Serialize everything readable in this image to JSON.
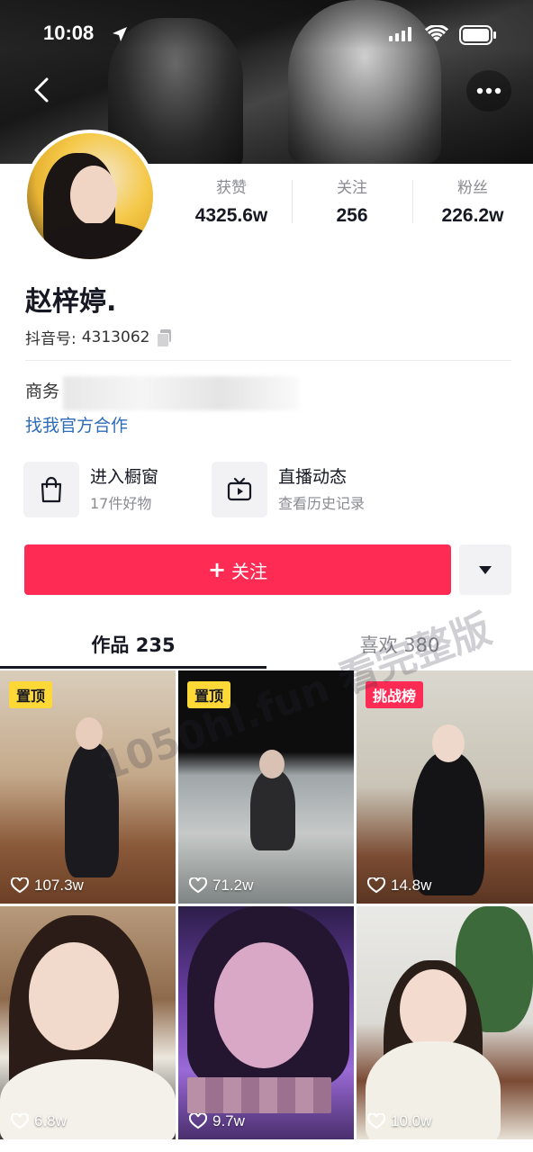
{
  "status_bar": {
    "time": "10:08"
  },
  "profile": {
    "name": "赵梓婷.",
    "douyin_id_label": "抖音号:",
    "douyin_id": "4313062",
    "business_label": "商务",
    "official_link": "找我官方合作"
  },
  "stats": [
    {
      "label": "获赞",
      "value": "4325.6w"
    },
    {
      "label": "关注",
      "value": "256"
    },
    {
      "label": "粉丝",
      "value": "226.2w"
    }
  ],
  "features": [
    {
      "title": "进入橱窗",
      "subtitle": "17件好物",
      "icon": "shopping-bag-icon"
    },
    {
      "title": "直播动态",
      "subtitle": "查看历史记录",
      "icon": "tv-icon"
    }
  ],
  "follow_button": {
    "plus": "+",
    "label": "关注"
  },
  "tabs": [
    {
      "label": "作品 235"
    },
    {
      "label": "喜欢 380"
    }
  ],
  "videos": [
    {
      "badge": "置顶",
      "likes": "107.3w"
    },
    {
      "badge": "置顶",
      "likes": "71.2w"
    },
    {
      "badge": "挑战榜",
      "likes": "14.8w"
    },
    {
      "badge": "",
      "likes": "6.8w"
    },
    {
      "badge": "",
      "likes": "9.7w"
    },
    {
      "badge": "",
      "likes": "10.0w"
    }
  ],
  "watermark": "1050hl.fun 看完整版",
  "colors": {
    "accent": "#fe2c55",
    "pin_badge": "#fdd836",
    "link": "#2d6cb8"
  }
}
